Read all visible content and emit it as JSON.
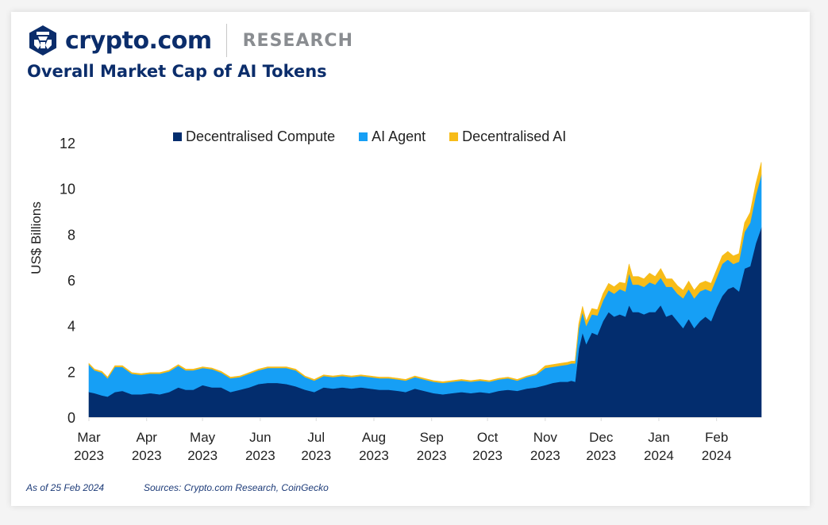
{
  "header": {
    "brand": "crypto.com",
    "section": "RESEARCH",
    "title": "Overall Market Cap of AI Tokens"
  },
  "footer": {
    "as_of": "As of 25 Feb 2024",
    "sources": "Sources: Crypto.com Research, CoinGecko"
  },
  "colors": {
    "brand": "#0b2d6b",
    "decentralised_compute": "#032d6e",
    "ai_agent": "#169ff5",
    "decentralised_ai": "#f7bc18"
  },
  "chart_data": {
    "type": "area",
    "stacked": true,
    "title": "Overall Market Cap of AI Tokens",
    "xlabel": "",
    "ylabel": "US$ Billions",
    "ylim": [
      0,
      12
    ],
    "yticks": [
      0,
      2,
      4,
      6,
      8,
      10,
      12
    ],
    "xlim": [
      "2023-03-01",
      "2024-02-25"
    ],
    "xticks": [
      {
        "date": "2023-03-01",
        "label": [
          "Mar",
          "2023"
        ]
      },
      {
        "date": "2023-04-01",
        "label": [
          "Apr",
          "2023"
        ]
      },
      {
        "date": "2023-05-01",
        "label": [
          "May",
          "2023"
        ]
      },
      {
        "date": "2023-06-01",
        "label": [
          "Jun",
          "2023"
        ]
      },
      {
        "date": "2023-07-01",
        "label": [
          "Jul",
          "2023"
        ]
      },
      {
        "date": "2023-08-01",
        "label": [
          "Aug",
          "2023"
        ]
      },
      {
        "date": "2023-09-01",
        "label": [
          "Sep",
          "2023"
        ]
      },
      {
        "date": "2023-10-01",
        "label": [
          "Oct",
          "2023"
        ]
      },
      {
        "date": "2023-11-01",
        "label": [
          "Nov",
          "2023"
        ]
      },
      {
        "date": "2023-12-01",
        "label": [
          "Dec",
          "2023"
        ]
      },
      {
        "date": "2024-01-01",
        "label": [
          "Jan",
          "2024"
        ]
      },
      {
        "date": "2024-02-01",
        "label": [
          "Feb",
          "2024"
        ]
      }
    ],
    "grid": false,
    "legend_position": "top-center",
    "x": [
      "2023-03-01",
      "2023-03-04",
      "2023-03-08",
      "2023-03-11",
      "2023-03-15",
      "2023-03-19",
      "2023-03-24",
      "2023-03-29",
      "2023-04-03",
      "2023-04-08",
      "2023-04-13",
      "2023-04-18",
      "2023-04-22",
      "2023-04-26",
      "2023-05-01",
      "2023-05-06",
      "2023-05-11",
      "2023-05-16",
      "2023-05-21",
      "2023-05-26",
      "2023-05-31",
      "2023-06-05",
      "2023-06-10",
      "2023-06-15",
      "2023-06-20",
      "2023-06-25",
      "2023-06-30",
      "2023-07-05",
      "2023-07-10",
      "2023-07-15",
      "2023-07-20",
      "2023-07-25",
      "2023-07-30",
      "2023-08-04",
      "2023-08-09",
      "2023-08-14",
      "2023-08-18",
      "2023-08-23",
      "2023-08-28",
      "2023-09-02",
      "2023-09-07",
      "2023-09-12",
      "2023-09-17",
      "2023-09-22",
      "2023-09-27",
      "2023-10-02",
      "2023-10-07",
      "2023-10-12",
      "2023-10-17",
      "2023-10-22",
      "2023-10-27",
      "2023-11-01",
      "2023-11-05",
      "2023-11-09",
      "2023-11-13",
      "2023-11-15",
      "2023-11-17",
      "2023-11-19",
      "2023-11-21",
      "2023-11-23",
      "2023-11-26",
      "2023-11-29",
      "2023-12-02",
      "2023-12-05",
      "2023-12-08",
      "2023-12-11",
      "2023-12-14",
      "2023-12-16",
      "2023-12-18",
      "2023-12-21",
      "2023-12-24",
      "2023-12-27",
      "2023-12-30",
      "2024-01-02",
      "2024-01-05",
      "2024-01-08",
      "2024-01-11",
      "2024-01-14",
      "2024-01-17",
      "2024-01-20",
      "2024-01-23",
      "2024-01-26",
      "2024-01-29",
      "2024-02-01",
      "2024-02-04",
      "2024-02-07",
      "2024-02-10",
      "2024-02-13",
      "2024-02-16",
      "2024-02-19",
      "2024-02-22",
      "2024-02-25"
    ],
    "series": [
      {
        "name": "Decentralised Compute",
        "values": [
          1.1,
          1.05,
          0.95,
          0.9,
          1.1,
          1.15,
          1.0,
          1.0,
          1.05,
          1.0,
          1.1,
          1.3,
          1.2,
          1.2,
          1.4,
          1.3,
          1.3,
          1.1,
          1.2,
          1.3,
          1.45,
          1.5,
          1.5,
          1.45,
          1.35,
          1.2,
          1.1,
          1.3,
          1.25,
          1.3,
          1.25,
          1.3,
          1.25,
          1.2,
          1.2,
          1.15,
          1.1,
          1.25,
          1.15,
          1.05,
          1.0,
          1.05,
          1.1,
          1.05,
          1.1,
          1.05,
          1.15,
          1.2,
          1.15,
          1.25,
          1.3,
          1.4,
          1.5,
          1.55,
          1.55,
          1.6,
          1.55,
          3.0,
          3.7,
          3.2,
          3.7,
          3.6,
          4.2,
          4.6,
          4.4,
          4.5,
          4.4,
          4.9,
          4.6,
          4.6,
          4.5,
          4.6,
          4.6,
          4.9,
          4.4,
          4.5,
          4.2,
          3.9,
          4.3,
          3.9,
          4.2,
          4.4,
          4.2,
          4.8,
          5.3,
          5.6,
          5.7,
          5.5,
          6.5,
          6.6,
          7.6,
          8.3
        ]
      },
      {
        "name": "AI Agent",
        "values": [
          1.2,
          1.0,
          1.0,
          0.8,
          1.1,
          1.05,
          0.9,
          0.85,
          0.85,
          0.9,
          0.9,
          0.95,
          0.85,
          0.85,
          0.75,
          0.8,
          0.65,
          0.6,
          0.55,
          0.6,
          0.6,
          0.65,
          0.65,
          0.7,
          0.7,
          0.55,
          0.5,
          0.5,
          0.5,
          0.5,
          0.5,
          0.5,
          0.5,
          0.5,
          0.5,
          0.5,
          0.5,
          0.5,
          0.5,
          0.5,
          0.5,
          0.5,
          0.5,
          0.5,
          0.5,
          0.5,
          0.5,
          0.5,
          0.45,
          0.5,
          0.55,
          0.75,
          0.7,
          0.7,
          0.75,
          0.75,
          0.8,
          0.9,
          0.9,
          0.8,
          0.8,
          0.85,
          0.9,
          0.95,
          1.0,
          1.1,
          1.1,
          1.4,
          1.2,
          1.2,
          1.2,
          1.3,
          1.2,
          1.2,
          1.3,
          1.2,
          1.2,
          1.3,
          1.3,
          1.3,
          1.3,
          1.2,
          1.3,
          1.3,
          1.4,
          1.3,
          1.0,
          1.3,
          1.6,
          1.9,
          2.1,
          2.3
        ]
      },
      {
        "name": "Decentralised AI",
        "values": [
          0.05,
          0.05,
          0.05,
          0.05,
          0.05,
          0.05,
          0.05,
          0.05,
          0.05,
          0.05,
          0.05,
          0.05,
          0.05,
          0.05,
          0.05,
          0.05,
          0.05,
          0.05,
          0.05,
          0.05,
          0.05,
          0.05,
          0.05,
          0.05,
          0.05,
          0.05,
          0.05,
          0.05,
          0.05,
          0.05,
          0.05,
          0.05,
          0.05,
          0.05,
          0.05,
          0.05,
          0.05,
          0.05,
          0.05,
          0.05,
          0.05,
          0.05,
          0.05,
          0.05,
          0.05,
          0.05,
          0.05,
          0.05,
          0.05,
          0.05,
          0.05,
          0.1,
          0.1,
          0.1,
          0.1,
          0.1,
          0.1,
          0.2,
          0.25,
          0.2,
          0.25,
          0.25,
          0.3,
          0.3,
          0.3,
          0.3,
          0.35,
          0.4,
          0.35,
          0.35,
          0.35,
          0.4,
          0.35,
          0.4,
          0.35,
          0.35,
          0.35,
          0.35,
          0.35,
          0.35,
          0.35,
          0.35,
          0.35,
          0.35,
          0.35,
          0.35,
          0.35,
          0.35,
          0.4,
          0.45,
          0.5,
          0.55
        ]
      }
    ]
  }
}
